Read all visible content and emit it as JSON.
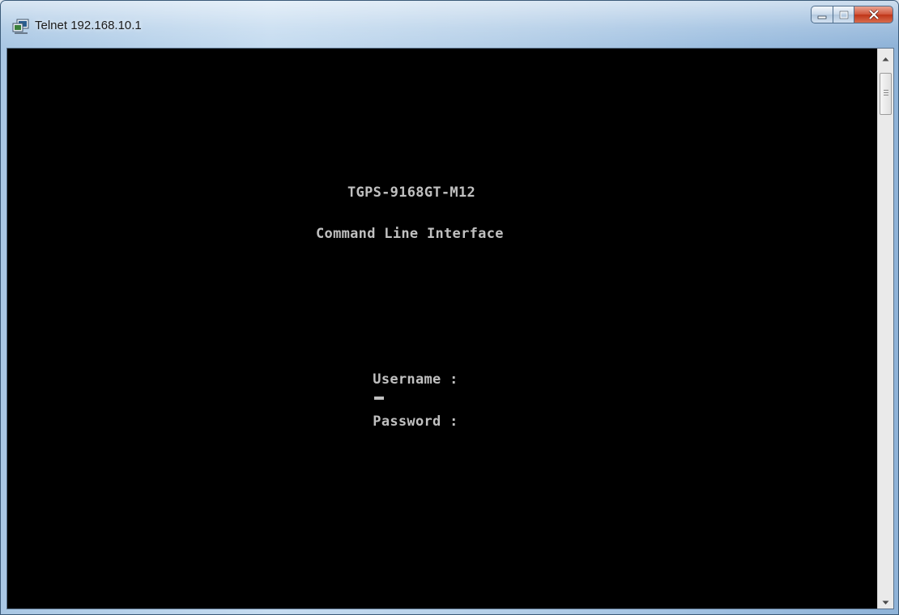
{
  "window": {
    "title": "Telnet 192.168.10.1",
    "icon": "telnet-terminal-icon"
  },
  "controls": {
    "minimize_icon": "minimize-icon",
    "maximize_icon": "maximize-icon",
    "close_icon": "close-icon"
  },
  "terminal": {
    "device_name": "TGPS-9168GT-M12",
    "subtitle": "Command Line Interface",
    "username_prompt": "Username :",
    "password_prompt": "Password :",
    "text_color": "#c0c0c0",
    "background_color": "#000000"
  },
  "scrollbar": {
    "up_icon": "scroll-up-arrow-icon",
    "down_icon": "scroll-down-arrow-icon"
  }
}
